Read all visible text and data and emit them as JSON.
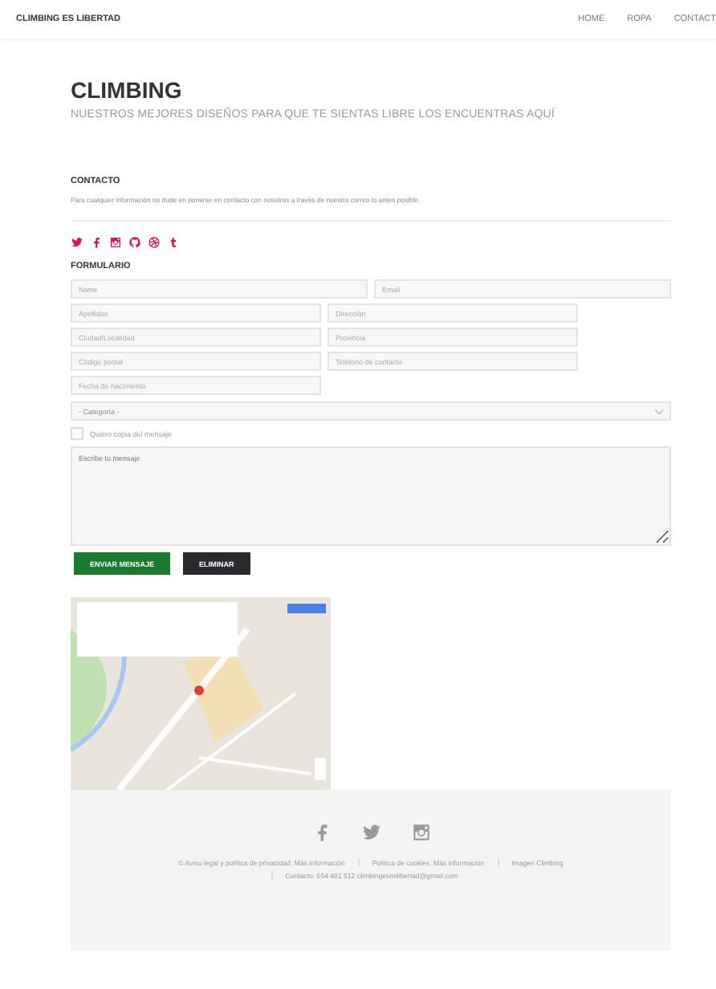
{
  "nav": {
    "brand": "CLIMBING ES LIBERTAD",
    "links": [
      {
        "label": "HOME",
        "selected": false
      },
      {
        "label": "ROPA",
        "selected": false
      },
      {
        "label": "CONTACT",
        "selected": false
      }
    ]
  },
  "header": {
    "title": "CLIMBING",
    "subtitle": "NUESTROS MEJORES DISEÑOS PARA QUE TE SIENTAS LIBRE LOS ENCUENTRAS AQUÍ"
  },
  "contact": {
    "heading": "CONTACTO",
    "text": "Para cualquier información no dude en ponerse en contacto con nosotros a través de nuestro correo lo antes posible."
  },
  "form": {
    "heading": "FORMULARIO",
    "rows": [
      {
        "fields": [
          {
            "placeholder": "Name",
            "wide": true
          },
          {
            "placeholder": "Email",
            "wide": true
          }
        ]
      },
      {
        "fields": [
          {
            "placeholder": "Apellidos",
            "wide": false
          },
          {
            "placeholder": "Dirección",
            "wide": false
          }
        ]
      },
      {
        "fields": [
          {
            "placeholder": "Ciudad/Localidad",
            "wide": false
          },
          {
            "placeholder": "Provincia",
            "wide": false
          }
        ]
      },
      {
        "fields": [
          {
            "placeholder": "Código postal",
            "wide": false
          },
          {
            "placeholder": "Teléfono de contacto",
            "wide": false
          }
        ]
      },
      {
        "fields": [
          {
            "placeholder": "Fecha de nacimiento",
            "wide": false
          }
        ]
      }
    ],
    "select": "- Categoría -",
    "copy": {
      "label": "Quiero copia del mensaje",
      "checked": false
    },
    "message": {
      "placeholder": "Escribe tu mensaje"
    },
    "buttons": [
      {
        "label": "ENVIAR MENSAJE",
        "kind": "primary"
      },
      {
        "label": "ELIMINAR",
        "kind": "secondary"
      }
    ]
  },
  "footer": {
    "links": [
      "© Aviso legal y política de privacidad. Más información",
      "Política de cookies. Más información",
      "Imagen Climbing",
      "Contacto: 654 481 512 climbingesmilibertad@gmail.com"
    ]
  }
}
